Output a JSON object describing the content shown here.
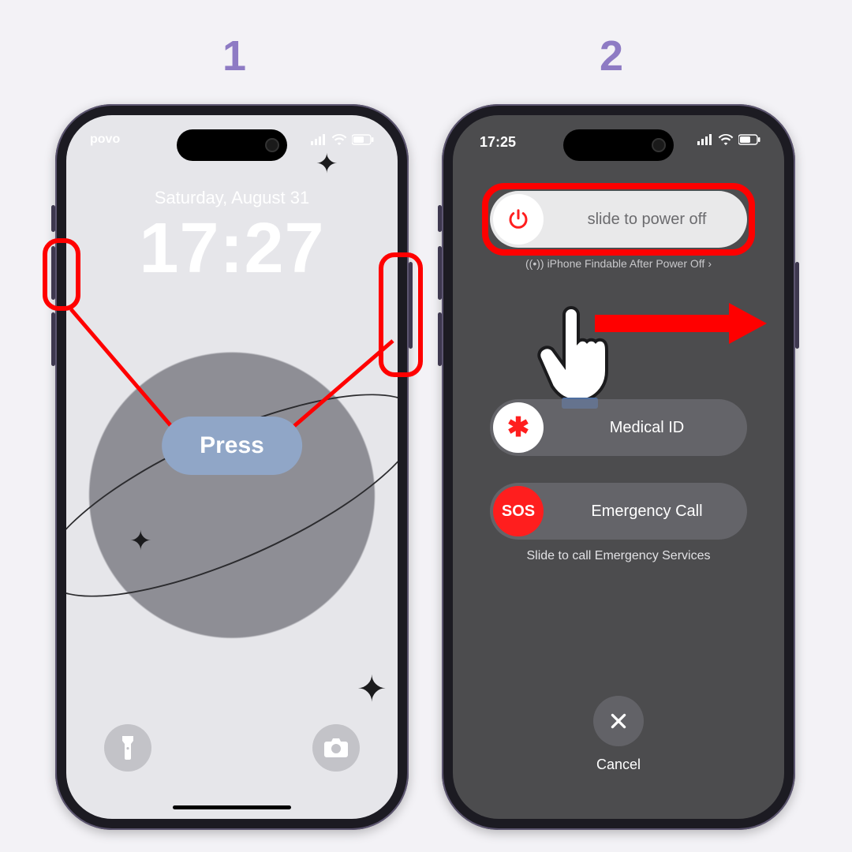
{
  "steps": {
    "one": "1",
    "two": "2"
  },
  "phone1": {
    "carrier": "povo",
    "date": "Saturday, August 31",
    "time": "17:27",
    "press_label": "Press",
    "torch_icon": "flashlight-icon",
    "camera_icon": "camera-icon"
  },
  "phone2": {
    "time": "17:25",
    "power_slider_label": "slide to power off",
    "findable_text": "iPhone Findable After Power Off",
    "medical_label": "Medical ID",
    "sos_knob_text": "SOS",
    "sos_label": "Emergency Call",
    "emergency_hint": "Slide to call Emergency Services",
    "cancel_label": "Cancel"
  },
  "colors": {
    "annotation_red": "#ff0000",
    "step_purple": "#8e7bc4",
    "press_pill": "#90a6c7"
  }
}
